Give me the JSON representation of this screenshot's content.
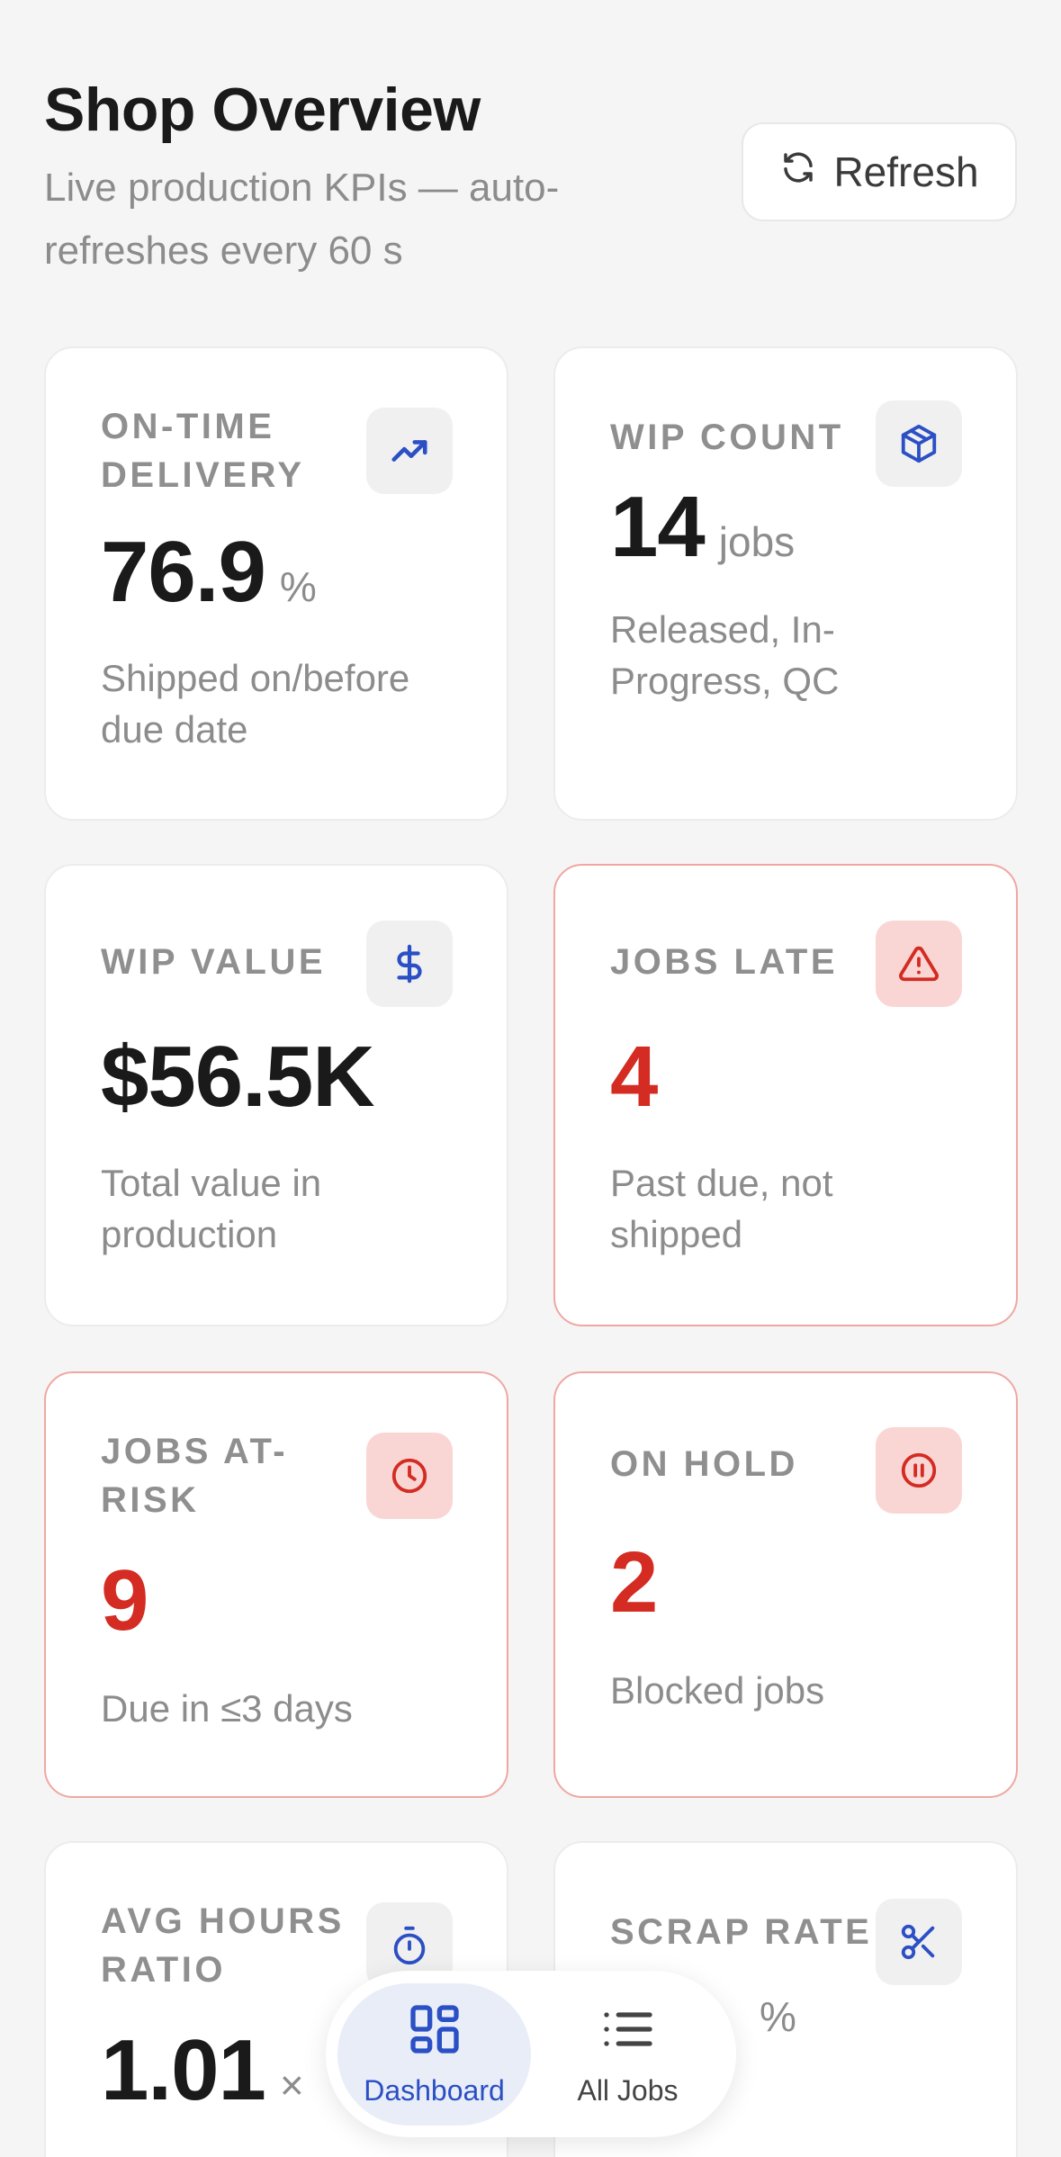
{
  "header": {
    "title": "Shop Overview",
    "subtitle": "Live production KPIs — auto-refreshes every 60 s",
    "refresh_label": "Refresh"
  },
  "colors": {
    "accent": "#2b4fc4",
    "alert": "#d42b22",
    "alert_border": "#f0a7a2",
    "alert_icon_bg": "#f9d6d4"
  },
  "kpis": [
    {
      "label": "ON-TIME DELIVERY",
      "value": "76.9",
      "unit": "%",
      "desc": "Shipped on/before due date",
      "icon": "trending-up-icon",
      "alert": false
    },
    {
      "label": "WIP COUNT",
      "value": "14",
      "unit": "jobs",
      "desc": "Released, In-Progress, QC",
      "icon": "package-icon",
      "alert": false
    },
    {
      "label": "WIP VALUE",
      "value": "$56.5K",
      "unit": "",
      "desc": "Total value in production",
      "icon": "dollar-icon",
      "alert": false
    },
    {
      "label": "JOBS LATE",
      "value": "4",
      "unit": "",
      "desc": "Past due, not shipped",
      "icon": "warning-triangle-icon",
      "alert": true
    },
    {
      "label": "JOBS AT-RISK",
      "value": "9",
      "unit": "",
      "desc": "Due in ≤3 days",
      "icon": "clock-icon",
      "alert": true
    },
    {
      "label": "ON HOLD",
      "value": "2",
      "unit": "",
      "desc": "Blocked jobs",
      "icon": "pause-circle-icon",
      "alert": true
    },
    {
      "label": "AVG HOURS RATIO",
      "value": "1.01",
      "unit": "×",
      "desc": "",
      "icon": "stopwatch-icon",
      "alert": false
    },
    {
      "label": "SCRAP RATE",
      "value": "",
      "unit": "%",
      "desc": "",
      "icon": "scissors-icon",
      "alert": false
    }
  ],
  "nav": {
    "dashboard_label": "Dashboard",
    "all_jobs_label": "All Jobs"
  }
}
